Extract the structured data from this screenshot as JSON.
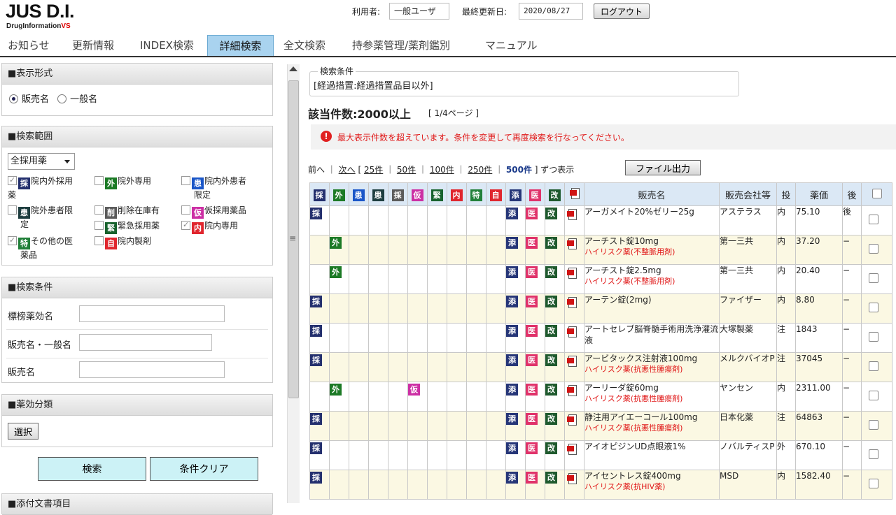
{
  "header": {
    "logo": "JUS D.I.",
    "logo_sub": "DrugInformation",
    "logo_sub_vs": "VS",
    "user_label": "利用者:",
    "user_value": "一般ユーザ",
    "updated_label": "最終更新日:",
    "updated_value": "2020/08/27",
    "logout": "ログアウト"
  },
  "nav": {
    "tabs": [
      "お知らせ",
      "更新情報",
      "INDEX検索",
      "詳細検索",
      "全文検索",
      "持参薬管理/薬剤鑑別",
      "マニュアル"
    ],
    "active": "詳細検索"
  },
  "left": {
    "display_format": {
      "title": "■表示形式",
      "options": [
        "販売名",
        "一般名"
      ],
      "selected": "販売名"
    },
    "scope": {
      "title": "■検索範囲",
      "select_value": "全採用薬",
      "items": [
        {
          "badge": "採",
          "label": "院内外採用",
          "label2": "薬",
          "checked": true
        },
        {
          "badge": "外",
          "label": "院外専用",
          "checked": false
        },
        {
          "badge": "患",
          "label": "院内外患者",
          "label2": "限定",
          "checked": false
        },
        {
          "badge": "患",
          "label": "院外患者限",
          "label2": "定",
          "checked": false
        },
        {
          "badge": "削",
          "label": "削除在庫有",
          "checked": false
        },
        {
          "badge": "仮",
          "label": "仮採用薬品",
          "checked": false
        },
        {
          "badge": "緊",
          "label": "緊急採用薬",
          "checked": false
        },
        {
          "badge": "内",
          "label": "院内専用",
          "checked": true
        },
        {
          "badge": "特",
          "label": "その他の医",
          "label2": "薬品",
          "checked": true
        },
        {
          "badge": "自",
          "label": "院内製剤",
          "checked": false
        }
      ]
    },
    "conditions": {
      "title": "■検索条件",
      "fields": [
        "標榜薬効名",
        "販売名・一般名",
        "販売名"
      ]
    },
    "efficacy": {
      "title": "■薬効分類",
      "select_button": "選択"
    },
    "search_button": "検索",
    "clear_button": "条件クリア",
    "bottom_title": "■添付文書項目"
  },
  "criteria": {
    "legend": "検索条件",
    "text": "[経過措置:経過措置品目以外]"
  },
  "results": {
    "count": "該当件数:2000以上",
    "page": "[ 1/4ページ ]",
    "warning": "最大表示件数を超えています。条件を変更して再度検索を行なってください。",
    "pager": {
      "prev": "前へ",
      "next": "次へ",
      "sizes": [
        "25件",
        "50件",
        "100件",
        "250件",
        "500件"
      ],
      "current": "500件",
      "suffix": "ずつ表示"
    },
    "export": "ファイル出力"
  },
  "table": {
    "badge_headers": [
      "採",
      "外",
      "患",
      "患",
      "採",
      "仮",
      "緊",
      "内",
      "特",
      "自",
      "添",
      "医",
      "改"
    ],
    "headers": {
      "name": "販売名",
      "company": "販売会社等",
      "route": "投",
      "price": "薬価",
      "post": "後"
    },
    "rows": [
      {
        "flags": [
          "採"
        ],
        "name": "アーガメイト20%ゼリー25g",
        "risk": "",
        "company": "アステラス",
        "route": "内",
        "price": "75.10",
        "post": "後"
      },
      {
        "flags": [
          "外"
        ],
        "name": "アーチスト錠10mg",
        "risk": "ハイリスク薬(不整脈用剤)",
        "company": "第一三共",
        "route": "内",
        "price": "37.20",
        "post": "−"
      },
      {
        "flags": [
          "外"
        ],
        "name": "アーチスト錠2.5mg",
        "risk": "ハイリスク薬(不整脈用剤)",
        "company": "第一三共",
        "route": "内",
        "price": "20.40",
        "post": "−"
      },
      {
        "flags": [
          "採"
        ],
        "name": "アーテン錠(2mg)",
        "risk": "",
        "company": "ファイザー",
        "route": "内",
        "price": "8.80",
        "post": "−"
      },
      {
        "flags": [
          "採"
        ],
        "name": "アートセレブ脳脊髄手術用洗浄灌流液",
        "risk": "",
        "company": "大塚製薬",
        "route": "注",
        "price": "1843",
        "post": "−"
      },
      {
        "flags": [
          "採"
        ],
        "name": "アービタックス注射液100mg",
        "risk": "ハイリスク薬(抗悪性腫瘍剤)",
        "company": "メルクバイオP",
        "route": "注",
        "price": "37045",
        "post": "−"
      },
      {
        "flags": [
          "外",
          "仮"
        ],
        "name": "アーリーダ錠60mg",
        "risk": "ハイリスク薬(抗悪性腫瘍剤)",
        "company": "ヤンセン",
        "route": "内",
        "price": "2311.00",
        "post": "−"
      },
      {
        "flags": [
          "採"
        ],
        "name": "静注用アイエーコール100mg",
        "risk": "ハイリスク薬(抗悪性腫瘍剤)",
        "company": "日本化薬",
        "route": "注",
        "price": "64863",
        "post": "−"
      },
      {
        "flags": [
          "採"
        ],
        "name": "アイオピジンUD点眼液1%",
        "risk": "",
        "company": "ノバルティスP",
        "route": "外",
        "price": "670.10",
        "post": "−"
      },
      {
        "flags": [
          "採"
        ],
        "name": "アイセントレス錠400mg",
        "risk": "ハイリスク薬(抗HIV薬)",
        "company": "MSD",
        "route": "内",
        "price": "1582.40",
        "post": "−"
      }
    ]
  }
}
